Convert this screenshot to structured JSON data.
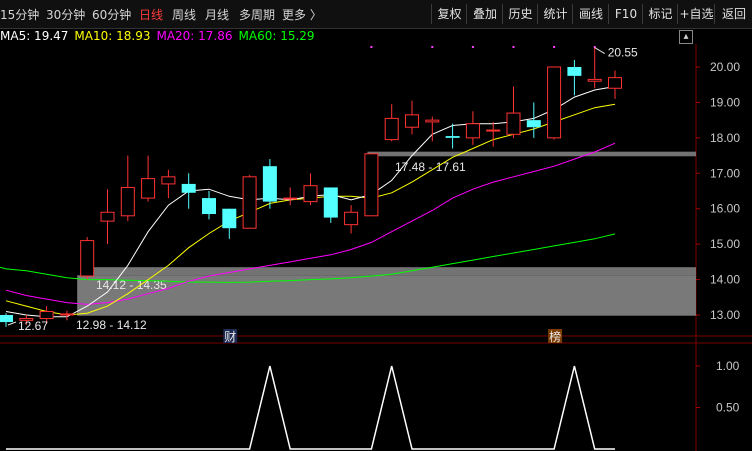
{
  "toolbar": {
    "periods": [
      "15分钟",
      "30分钟",
      "60分钟",
      "日线",
      "周线",
      "月线",
      "多周期",
      "更多 〉"
    ],
    "selected": "日线",
    "buttons": [
      "复权",
      "叠加",
      "历史",
      "统计",
      "画线",
      "F10",
      "标记",
      "+自选",
      "返回"
    ]
  },
  "ma_legend": [
    {
      "label": "MA5: 19.47",
      "color": "#ffffff"
    },
    {
      "label": "MA10: 18.93",
      "color": "#ffff00"
    },
    {
      "label": "MA20: 17.86",
      "color": "#ff00ff"
    },
    {
      "label": "MA60: 15.29",
      "color": "#00ff00"
    }
  ],
  "collapse_icon": "collapse-up-icon",
  "colors": {
    "up": "#ff3232",
    "down": "#54ffff",
    "ma5": "#ffffff",
    "ma10": "#ffff00",
    "ma20": "#ff00ff",
    "ma60": "#00ff00",
    "zone": "#808080"
  },
  "chart_data": {
    "type": "candlestick",
    "y_axis": {
      "ticks": [
        13.0,
        14.0,
        15.0,
        16.0,
        17.0,
        18.0,
        19.0,
        20.0
      ],
      "labels": [
        "13.00",
        "14.00",
        "15.00",
        "16.00",
        "17.00",
        "18.00",
        "19.00",
        "20.00"
      ],
      "range": [
        12.6,
        21.4
      ]
    },
    "candles": [
      {
        "o": 13.0,
        "c": 12.8,
        "h": 13.05,
        "l": 12.67
      },
      {
        "o": 12.85,
        "c": 12.9,
        "h": 13.0,
        "l": 12.72
      },
      {
        "o": 12.9,
        "c": 13.1,
        "h": 13.25,
        "l": 12.75
      },
      {
        "o": 13.0,
        "c": 13.03,
        "h": 13.12,
        "l": 12.85
      },
      {
        "o": 14.1,
        "c": 15.1,
        "h": 15.2,
        "l": 14.0
      },
      {
        "o": 15.65,
        "c": 15.9,
        "h": 16.55,
        "l": 15.0
      },
      {
        "o": 15.8,
        "c": 16.6,
        "h": 17.5,
        "l": 15.65
      },
      {
        "o": 16.3,
        "c": 16.85,
        "h": 17.5,
        "l": 16.2
      },
      {
        "o": 16.7,
        "c": 16.9,
        "h": 17.1,
        "l": 16.3
      },
      {
        "o": 16.7,
        "c": 16.45,
        "h": 17.0,
        "l": 16.0
      },
      {
        "o": 16.3,
        "c": 15.85,
        "h": 16.5,
        "l": 15.7
      },
      {
        "o": 16.0,
        "c": 15.45,
        "h": 16.0,
        "l": 15.15
      },
      {
        "o": 15.45,
        "c": 16.9,
        "h": 16.95,
        "l": 15.45
      },
      {
        "o": 17.2,
        "c": 16.2,
        "h": 17.4,
        "l": 16.0
      },
      {
        "o": 16.3,
        "c": 16.3,
        "h": 16.6,
        "l": 16.1
      },
      {
        "o": 16.2,
        "c": 16.65,
        "h": 17.0,
        "l": 16.1
      },
      {
        "o": 16.6,
        "c": 15.75,
        "h": 16.6,
        "l": 15.6
      },
      {
        "o": 15.55,
        "c": 15.9,
        "h": 16.1,
        "l": 15.3
      },
      {
        "o": 15.8,
        "c": 17.55,
        "h": 17.55,
        "l": 15.8
      },
      {
        "o": 17.95,
        "c": 18.55,
        "h": 18.95,
        "l": 17.9
      },
      {
        "o": 18.3,
        "c": 18.65,
        "h": 19.05,
        "l": 18.1
      },
      {
        "o": 18.45,
        "c": 18.5,
        "h": 18.6,
        "l": 17.9
      },
      {
        "o": 18.05,
        "c": 18.0,
        "h": 18.4,
        "l": 17.7
      },
      {
        "o": 18.0,
        "c": 18.4,
        "h": 18.75,
        "l": 17.8
      },
      {
        "o": 18.2,
        "c": 18.22,
        "h": 18.45,
        "l": 17.75
      },
      {
        "o": 18.1,
        "c": 18.7,
        "h": 19.45,
        "l": 18.0
      },
      {
        "o": 18.5,
        "c": 18.3,
        "h": 19.0,
        "l": 18.0
      },
      {
        "o": 18.0,
        "c": 20.0,
        "h": 20.0,
        "l": 17.95
      },
      {
        "o": 20.0,
        "c": 19.75,
        "h": 20.2,
        "l": 19.2
      },
      {
        "o": 19.6,
        "c": 19.65,
        "h": 20.55,
        "l": 19.4
      },
      {
        "o": 19.4,
        "c": 19.7,
        "h": 19.9,
        "l": 19.1
      }
    ],
    "ma5": [
      13.1,
      13.0,
      12.95,
      12.95,
      13.25,
      13.65,
      14.4,
      15.35,
      16.1,
      16.5,
      16.55,
      16.35,
      16.25,
      16.3,
      16.25,
      16.35,
      16.4,
      16.25,
      16.4,
      16.8,
      17.5,
      18.1,
      18.35,
      18.4,
      18.4,
      18.45,
      18.55,
      18.8,
      19.15,
      19.35,
      19.45
    ],
    "ma10": [
      13.4,
      13.25,
      13.1,
      13.0,
      13.05,
      13.25,
      13.6,
      14.0,
      14.4,
      14.9,
      15.3,
      15.65,
      15.9,
      16.15,
      16.25,
      16.3,
      16.35,
      16.35,
      16.3,
      16.45,
      16.75,
      17.1,
      17.45,
      17.7,
      17.95,
      18.1,
      18.25,
      18.45,
      18.65,
      18.85,
      18.95
    ],
    "ma20": [
      13.7,
      13.55,
      13.45,
      13.35,
      13.3,
      13.35,
      13.45,
      13.6,
      13.75,
      13.95,
      14.1,
      14.2,
      14.3,
      14.4,
      14.5,
      14.6,
      14.7,
      14.85,
      15.05,
      15.35,
      15.65,
      15.95,
      16.3,
      16.55,
      16.75,
      16.9,
      17.05,
      17.2,
      17.4,
      17.6,
      17.85
    ],
    "ma60": [
      14.3,
      14.25,
      14.15,
      14.05,
      14.0,
      14.0,
      13.98,
      13.97,
      13.95,
      13.93,
      13.93,
      13.92,
      13.93,
      13.95,
      13.97,
      14.0,
      14.02,
      14.05,
      14.1,
      14.15,
      14.25,
      14.35,
      14.45,
      14.55,
      14.65,
      14.75,
      14.85,
      14.95,
      15.05,
      15.15,
      15.29
    ],
    "zones": [
      {
        "low": 17.48,
        "high": 17.61,
        "label": "17.48 - 17.61",
        "from_index": 18
      },
      {
        "low": 14.12,
        "high": 14.35,
        "label": "14.12 - 14.35",
        "from_index": 4
      },
      {
        "low": 12.98,
        "high": 14.12,
        "label": "12.98 - 14.12",
        "from_index": 4
      }
    ],
    "annotations": {
      "high": {
        "index": 29,
        "value": 20.55,
        "label": "20.55"
      },
      "low": {
        "index": 0,
        "value": 12.67,
        "label": "12.67"
      },
      "tags": [
        {
          "index": 11,
          "label": "财"
        },
        {
          "index": 27,
          "label": "榜"
        }
      ]
    },
    "signal_dots": [
      18,
      21,
      23,
      25,
      27,
      29
    ],
    "indicator": {
      "y_ticks": [
        0.5,
        1.0
      ],
      "y_labels": [
        "0.50",
        "1.00"
      ],
      "range": [
        0,
        1.2
      ],
      "values": [
        0,
        0,
        0,
        0,
        0,
        0,
        0,
        0,
        0,
        0,
        0,
        0,
        0,
        1,
        0,
        0,
        0,
        0,
        0,
        1,
        0,
        0,
        0,
        0,
        0,
        0,
        0,
        0,
        1,
        0,
        0
      ]
    }
  }
}
